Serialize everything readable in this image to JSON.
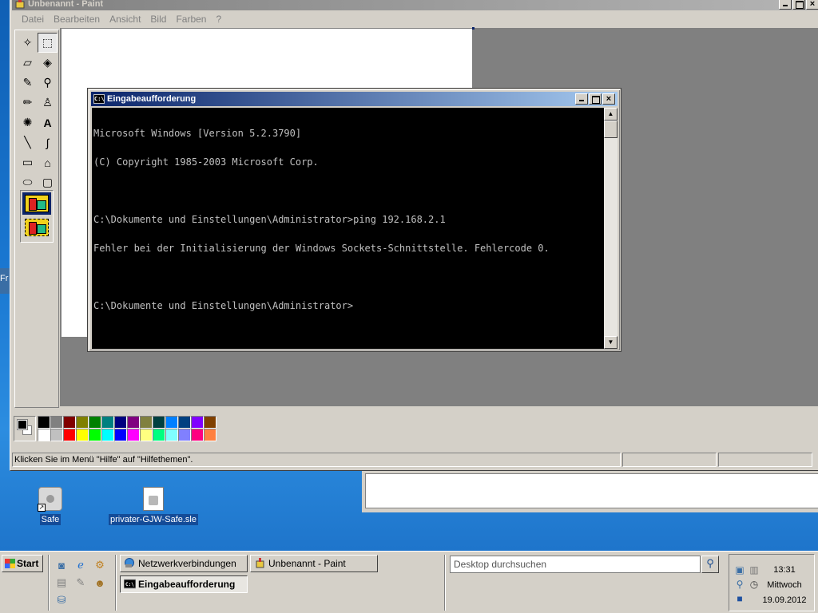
{
  "paint": {
    "title": "Unbenannt - Paint",
    "menu": [
      "Datei",
      "Bearbeiten",
      "Ansicht",
      "Bild",
      "Farben",
      "?"
    ],
    "tools": [
      {
        "name": "free-select-icon",
        "glyph": "✧"
      },
      {
        "name": "rect-select-icon",
        "glyph": "⬚"
      },
      {
        "name": "eraser-icon",
        "glyph": "▱"
      },
      {
        "name": "fill-bucket-icon",
        "glyph": "◈"
      },
      {
        "name": "color-picker-icon",
        "glyph": "✎"
      },
      {
        "name": "magnifier-icon",
        "glyph": "⚲"
      },
      {
        "name": "pencil-icon",
        "glyph": "✏"
      },
      {
        "name": "brush-icon",
        "glyph": "♙"
      },
      {
        "name": "airbrush-icon",
        "glyph": "✺"
      },
      {
        "name": "text-icon",
        "glyph": "A"
      },
      {
        "name": "line-icon",
        "glyph": "╲"
      },
      {
        "name": "curve-icon",
        "glyph": "∫"
      },
      {
        "name": "rectangle-icon",
        "glyph": "▭"
      },
      {
        "name": "polygon-icon",
        "glyph": "⌂"
      },
      {
        "name": "ellipse-icon",
        "glyph": "⬭"
      },
      {
        "name": "rounded-rect-icon",
        "glyph": "▢"
      }
    ],
    "palette_top": [
      "#000000",
      "#808080",
      "#800000",
      "#808000",
      "#008000",
      "#008080",
      "#000080",
      "#800080",
      "#808040",
      "#004040",
      "#0080ff",
      "#004080",
      "#8000ff",
      "#804000"
    ],
    "palette_bottom": [
      "#ffffff",
      "#c0c0c0",
      "#ff0000",
      "#ffff00",
      "#00ff00",
      "#00ffff",
      "#0000ff",
      "#ff00ff",
      "#ffff80",
      "#00ff80",
      "#80ffff",
      "#8080ff",
      "#ff0080",
      "#ff8040"
    ],
    "status_text": "Klicken Sie im Menü \"Hilfe\" auf \"Hilfethemen\"."
  },
  "cmd": {
    "title": "Eingabeaufforderung",
    "lines": [
      "Microsoft Windows [Version 5.2.3790]",
      "(C) Copyright 1985-2003 Microsoft Corp.",
      "",
      "C:\\Dokumente und Einstellungen\\Administrator>ping 192.168.2.1",
      "Fehler bei der Initialisierung der Windows Sockets-Schnittstelle. Fehlercode 0.",
      "",
      "C:\\Dokumente und Einstellungen\\Administrator>"
    ]
  },
  "desktop": {
    "peek_text": "Fr",
    "icons": [
      {
        "label": "Safe"
      },
      {
        "label": "privater-GJW-Safe.sle"
      }
    ]
  },
  "taskbar": {
    "start_label": "Start",
    "tasks": [
      {
        "label": "Netzwerkverbindungen",
        "icon": "network-icon"
      },
      {
        "label": "Unbenannt - Paint",
        "icon": "paint-icon"
      },
      {
        "label": "Eingabeaufforderung",
        "icon": "cmd-icon"
      }
    ],
    "search_placeholder": "Desktop durchsuchen",
    "clock": {
      "time": "13:31",
      "day": "Mittwoch",
      "date": "19.09.2012"
    }
  }
}
